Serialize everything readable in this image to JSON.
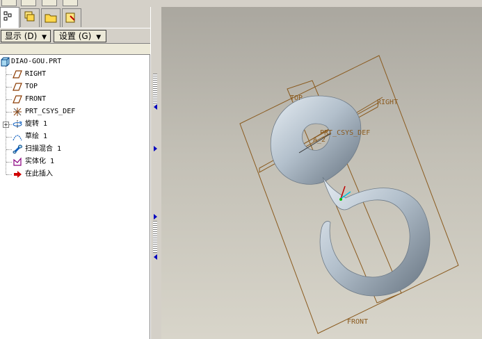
{
  "toolbar": {
    "buttons": [
      "datum-plane-display",
      "datum-axis-display",
      "datum-point-display",
      "coordinate-system-display"
    ]
  },
  "tabs": [
    {
      "icon": "model-tree-icon"
    },
    {
      "icon": "layers-icon"
    },
    {
      "icon": "folder-browser-icon"
    },
    {
      "icon": "favorites-icon"
    }
  ],
  "panel": {
    "show_label": "显示",
    "show_key": "(D)",
    "settings_label": "设置",
    "settings_key": "(G)"
  },
  "tree": {
    "root": "DIAO-GOU.PRT",
    "items": [
      {
        "label": "RIGHT",
        "icon": "datum-plane-icon"
      },
      {
        "label": "TOP",
        "icon": "datum-plane-icon"
      },
      {
        "label": "FRONT",
        "icon": "datum-plane-icon"
      },
      {
        "label": "PRT_CSYS_DEF",
        "icon": "csys-icon"
      },
      {
        "label": "旋转 1",
        "icon": "revolve-icon"
      },
      {
        "label": "草绘 1",
        "icon": "sketch-icon"
      },
      {
        "label": "扫描混合 1",
        "icon": "swept-blend-icon"
      },
      {
        "label": "实体化 1",
        "icon": "solidify-icon"
      },
      {
        "label": "在此插入",
        "icon": "insert-here-icon"
      }
    ]
  },
  "viewport": {
    "labels": {
      "top": "TOP",
      "right": "RIGHT",
      "front": "FRONT",
      "csys": "PRT_CSYS_DEF",
      "axis": "A_2"
    },
    "colors": {
      "datum": "#8a5a1e",
      "hook_light": "#e4ebf1",
      "hook_mid": "#a9b6c2",
      "hook_dark": "#5e6b78"
    }
  }
}
